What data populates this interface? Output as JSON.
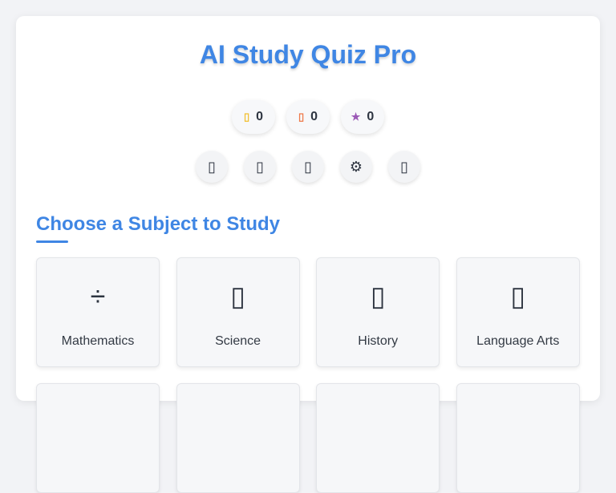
{
  "app": {
    "title": "AI Study Quiz Pro"
  },
  "stats": [
    {
      "icon": "coin-icon",
      "glyph": "▯",
      "value": "0",
      "color": "#f2c032"
    },
    {
      "icon": "streak-icon",
      "glyph": "▯",
      "value": "0",
      "color": "#ee7a4a"
    },
    {
      "icon": "star-icon",
      "glyph": "★",
      "value": "0",
      "color": "#9b59b6"
    }
  ],
  "toolbar": [
    {
      "icon": "toolbar-icon-1",
      "glyph": "▯"
    },
    {
      "icon": "toolbar-icon-2",
      "glyph": "▯"
    },
    {
      "icon": "toolbar-icon-3",
      "glyph": "▯"
    },
    {
      "icon": "settings-gear-icon",
      "glyph": "⚙"
    },
    {
      "icon": "toolbar-icon-5",
      "glyph": "▯"
    }
  ],
  "section": {
    "title": "Choose a Subject to Study"
  },
  "subjects": [
    {
      "label": "Mathematics",
      "icon": "divide-icon",
      "glyph": "÷"
    },
    {
      "label": "Science",
      "icon": "science-icon",
      "glyph": "▯"
    },
    {
      "label": "History",
      "icon": "history-icon",
      "glyph": "▯"
    },
    {
      "label": "Language Arts",
      "icon": "language-arts-icon",
      "glyph": "▯"
    },
    {
      "label": "",
      "icon": "subject-icon-5",
      "glyph": ""
    },
    {
      "label": "",
      "icon": "subject-icon-6",
      "glyph": ""
    },
    {
      "label": "",
      "icon": "subject-icon-7",
      "glyph": ""
    },
    {
      "label": "",
      "icon": "subject-icon-8",
      "glyph": ""
    }
  ],
  "colors": {
    "accent": "#3f86e4"
  }
}
